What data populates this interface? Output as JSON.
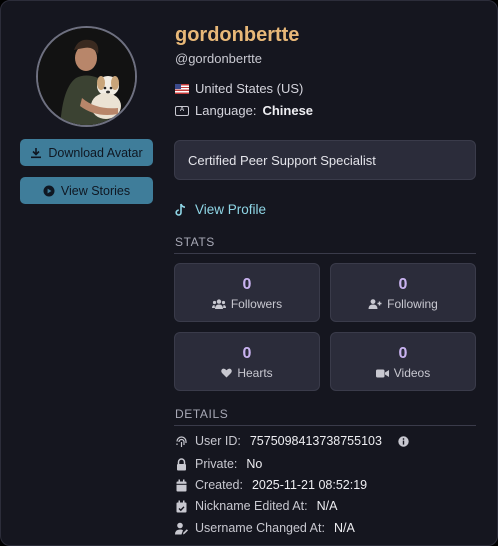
{
  "profile": {
    "display_name": "gordonbertte",
    "handle": "@gordonbertte",
    "country": "United States (US)",
    "language_label": "Language:",
    "language": "Chinese",
    "bio": "Certified Peer Support Specialist",
    "view_profile": "View Profile"
  },
  "buttons": {
    "download_avatar": "Download Avatar",
    "view_stories": "View Stories"
  },
  "stats": {
    "title": "STATS",
    "items": [
      {
        "value": "0",
        "label": "Followers",
        "icon": "users-icon"
      },
      {
        "value": "0",
        "label": "Following",
        "icon": "user-plus-icon"
      },
      {
        "value": "0",
        "label": "Hearts",
        "icon": "heart-icon"
      },
      {
        "value": "0",
        "label": "Videos",
        "icon": "video-icon"
      }
    ]
  },
  "details": {
    "title": "DETAILS",
    "user_id_label": "User ID:",
    "user_id": "7575098413738755103",
    "private_label": "Private:",
    "private": "No",
    "created_label": "Created:",
    "created": "2025-11-21 08:52:19",
    "nickname_label": "Nickname Edited At:",
    "nickname": "N/A",
    "username_label": "Username Changed At:",
    "username": "N/A"
  },
  "colors": {
    "background": "#15161f",
    "card": "#2b2c3a",
    "name": "#e8b878",
    "button": "#3f7d9a",
    "stat_value": "#c9b3f0",
    "link": "#8fd6e6"
  }
}
